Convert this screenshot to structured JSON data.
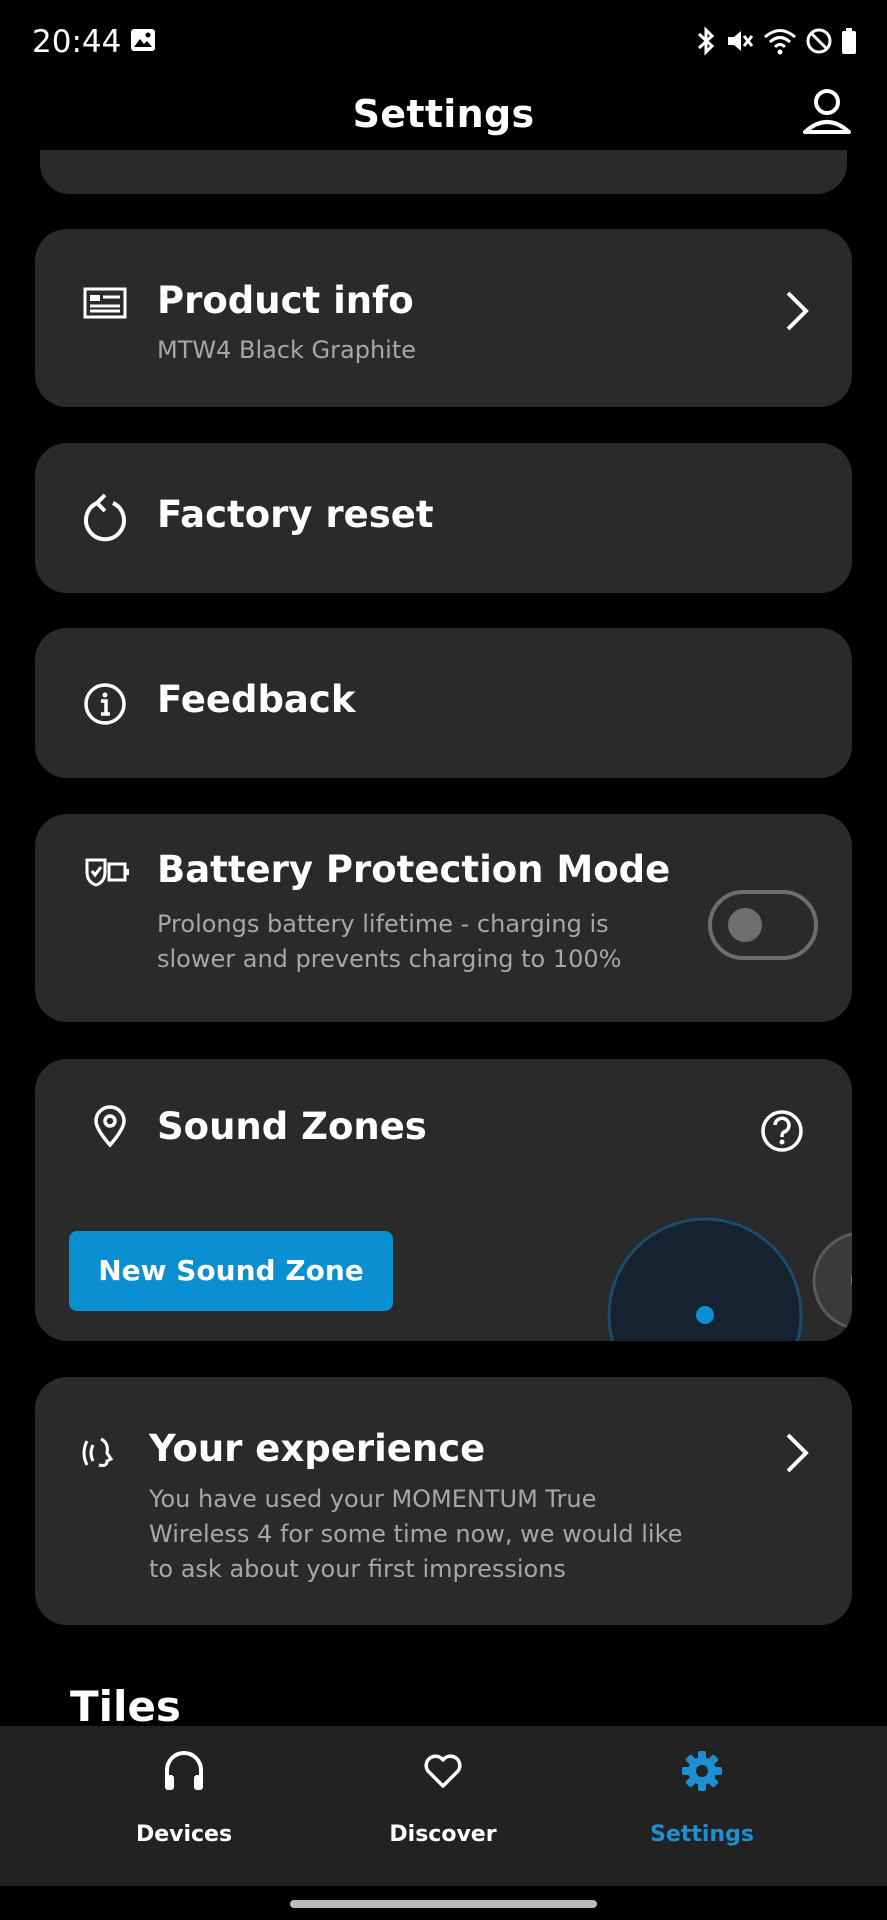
{
  "status_bar": {
    "time": "20:44"
  },
  "header": {
    "title": "Settings"
  },
  "cards": {
    "product_info": {
      "title": "Product info",
      "subtitle": "MTW4 Black Graphite"
    },
    "factory_reset": {
      "title": "Factory reset"
    },
    "feedback": {
      "title": "Feedback"
    },
    "battery_protection": {
      "title": "Battery Protection Mode",
      "description_line1": "Prolongs battery lifetime - charging is",
      "description_line2": "slower and prevents charging to 100%",
      "enabled": false
    },
    "sound_zones": {
      "title": "Sound Zones",
      "button_label": "New Sound Zone"
    },
    "your_experience": {
      "title": "Your experience",
      "line1": "You have used your MOMENTUM True",
      "line2": "Wireless 4 for some time now, we would like",
      "line3": "to ask about your first impressions"
    }
  },
  "tiles_heading": "Tiles",
  "bottom_nav": {
    "items": [
      {
        "label": "Devices",
        "icon": "headphones-icon",
        "active": false
      },
      {
        "label": "Discover",
        "icon": "heart-icon",
        "active": false
      },
      {
        "label": "Settings",
        "icon": "gear-icon",
        "active": true
      }
    ]
  },
  "colors": {
    "accent": "#0b8fd3",
    "card": "#2a2a2a",
    "background": "#000000",
    "nav_active": "#1e8fd0"
  }
}
